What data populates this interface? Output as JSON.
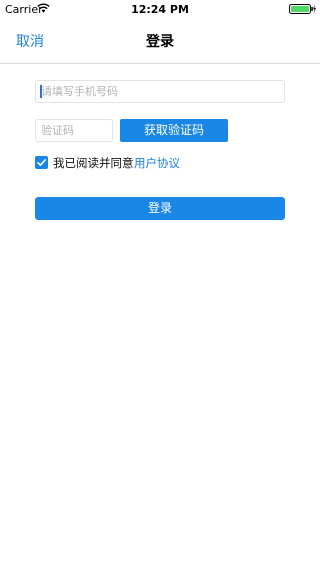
{
  "status_bar": {
    "carrier": "Carrier",
    "wifi_icon": "wifi-icon",
    "time": "12:24 PM",
    "battery_icon": "battery-icon",
    "charging_icon": "bolt-icon"
  },
  "nav": {
    "cancel_label": "取消",
    "title": "登录"
  },
  "form": {
    "phone_placeholder": "请填写手机号码",
    "phone_value": "",
    "code_placeholder": "验证码",
    "code_value": "",
    "get_code_label": "获取验证码",
    "agree_checked": true,
    "agree_text": "我已阅读并同意",
    "agreement_link": "用户协议",
    "login_label": "登录"
  },
  "colors": {
    "accent": "#1a87e6",
    "link": "#1d7fe8",
    "battery": "#4cd964"
  }
}
